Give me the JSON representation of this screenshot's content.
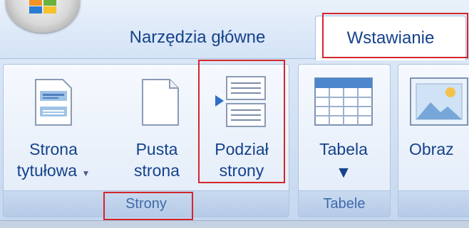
{
  "tabs": {
    "home": "Narzędzia główne",
    "insert": "Wstawianie"
  },
  "groups": {
    "pages": {
      "label": "Strony",
      "buttons": {
        "cover": {
          "line1": "Strona",
          "line2": "tytułowa",
          "dropdown": "▼"
        },
        "blank": {
          "line1": "Pusta",
          "line2": "strona"
        },
        "break": {
          "line1": "Podział",
          "line2": "strony"
        }
      }
    },
    "tables": {
      "label": "Tabele",
      "buttons": {
        "table": {
          "line1": "Tabela",
          "dropdown": "▼"
        }
      }
    },
    "illustrations": {
      "buttons": {
        "picture": {
          "line1": "Obraz"
        }
      }
    }
  },
  "icons": {
    "office": "office-logo-icon",
    "cover": "cover-page-icon",
    "blank": "blank-page-icon",
    "break": "page-break-icon",
    "table": "table-grid-icon",
    "picture": "picture-icon"
  },
  "colors": {
    "highlight": "#d3262a",
    "tab_text": "#15428b",
    "group_label_text": "#3e6aaa"
  }
}
